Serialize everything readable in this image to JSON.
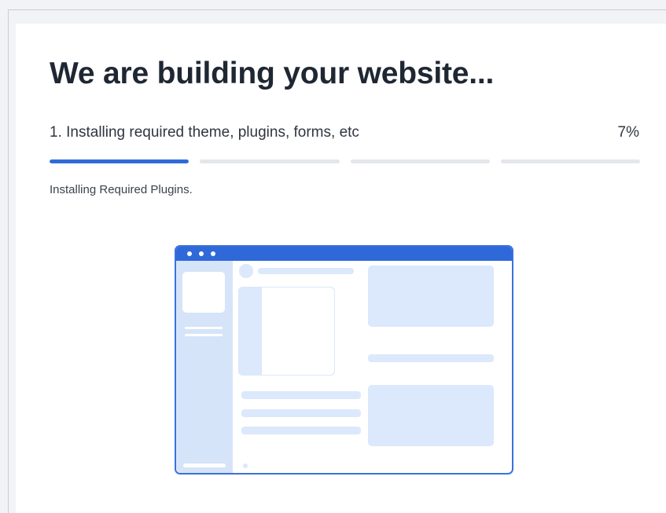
{
  "page": {
    "title": "We are building your website...",
    "step_label": "1. Installing required theme, plugins, forms, etc",
    "percent_text": "7%",
    "status_text": "Installing Required Plugins."
  },
  "progress": {
    "segments": [
      {
        "name": "step-1",
        "fill": 1.0
      },
      {
        "name": "step-2",
        "fill": 0
      },
      {
        "name": "step-3",
        "fill": 0
      },
      {
        "name": "step-4",
        "fill": 0
      }
    ],
    "overall_percent": 7
  },
  "colors": {
    "accent": "#2f6bd8",
    "track": "#e4e6ea",
    "illustration_fill": "#dce8fb",
    "title": "#1f2733"
  },
  "icons": {
    "illustration": "website-wireframe-illustration"
  }
}
